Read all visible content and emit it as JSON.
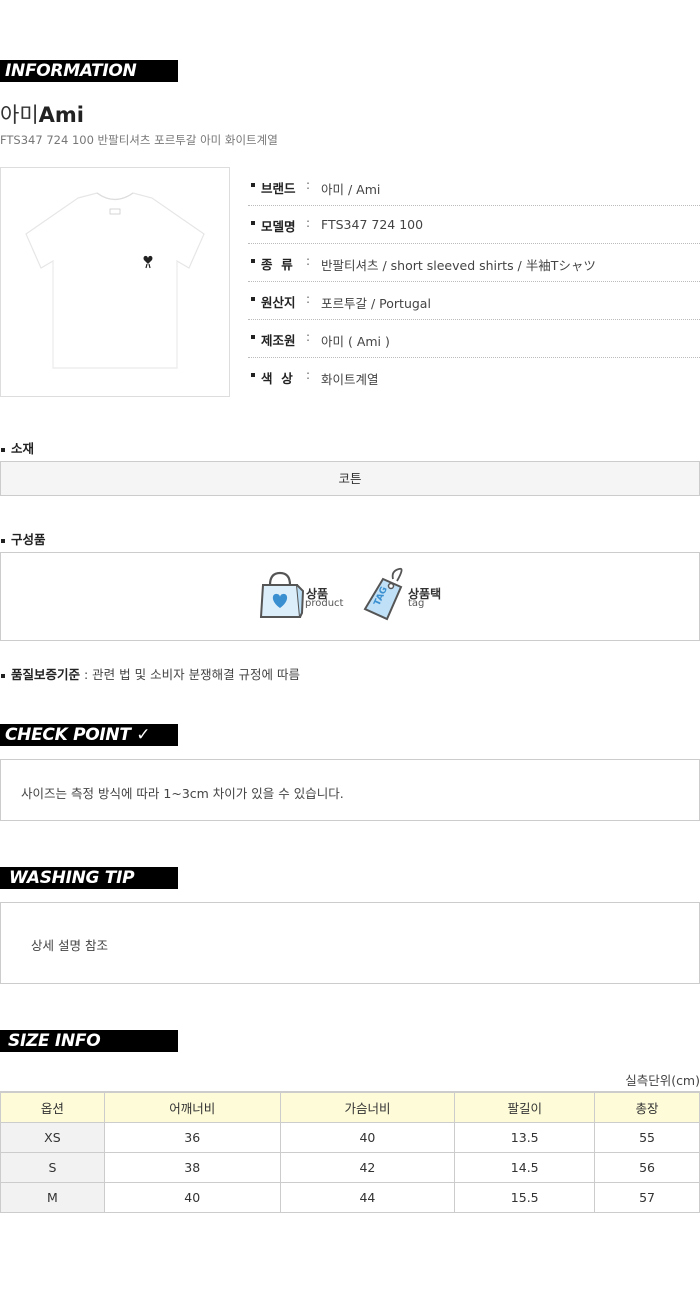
{
  "banners": {
    "information": "INFORMATION",
    "check_point": "CHECK POINT ✓",
    "washing_tip": "WASHING TIP",
    "size_info": "SIZE INFO"
  },
  "product": {
    "brand_ko": "아미",
    "brand_en": "Ami",
    "subtitle": "FTS347 724 100 반팔티셔츠 포르투갈 아미 화이트계열",
    "image_icon": "white-tshirt-image"
  },
  "specs": [
    {
      "label": "브랜드",
      "value": "아미 / Ami"
    },
    {
      "label": "모델명",
      "value": "FTS347 724 100"
    },
    {
      "label": "종  류",
      "value": "반팔티셔츠 / short sleeved shirts / 半袖Tシャツ"
    },
    {
      "label": "원산지",
      "value": "포르투갈 / Portugal"
    },
    {
      "label": "제조원",
      "value": "아미 ( Ami )"
    },
    {
      "label": "색  상",
      "value": "화이트계열"
    }
  ],
  "material": {
    "label": "소재",
    "value": "코튼"
  },
  "components": {
    "label": "구성품",
    "items": [
      {
        "icon": "shopping-bag-icon",
        "ko": "상품",
        "en": "product"
      },
      {
        "icon": "tag-icon",
        "ko": "상품택",
        "en": "tag",
        "tag_text": "TAG"
      }
    ]
  },
  "quality": {
    "label": "품질보증기준",
    "text": ": 관련 법 및 소비자 분쟁해결 규정에 따름"
  },
  "check_point_text": "사이즈는 측정 방식에 따라 1~3cm 차이가 있을 수 있습니다.",
  "washing_tip_text": "상세 설명 참조",
  "size": {
    "unit_label": "실측단위(cm)",
    "headers": [
      "옵션",
      "어깨너비",
      "가슴너비",
      "팔길이",
      "총장"
    ],
    "rows": [
      [
        "XS",
        "36",
        "40",
        "13.5",
        "55"
      ],
      [
        "S",
        "38",
        "42",
        "14.5",
        "56"
      ],
      [
        "M",
        "40",
        "44",
        "15.5",
        "57"
      ]
    ]
  },
  "colors": {
    "banner_bg": "#000000",
    "table_header_bg": "#fdfbd8",
    "icon_blue": "#3a8fd1"
  }
}
